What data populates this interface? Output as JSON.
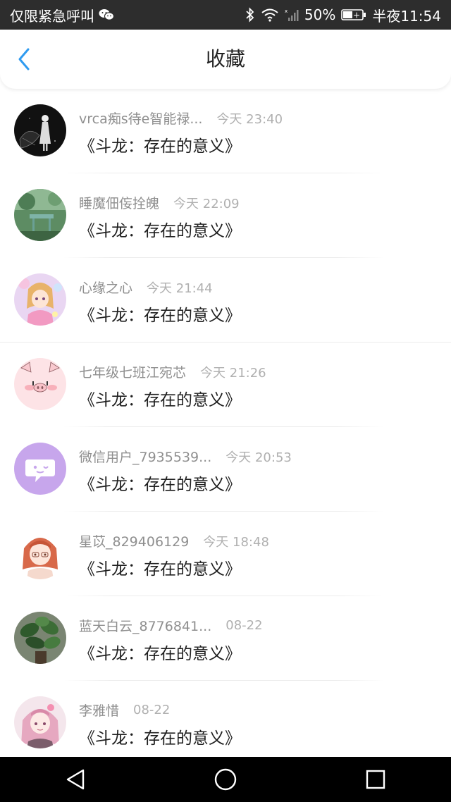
{
  "status_bar": {
    "left_text": "仅限紧急呼叫",
    "battery_percent": "50%",
    "clock": "半夜11:54",
    "icons": [
      "wechat-icon",
      "bluetooth-icon",
      "wifi-icon",
      "signal-icon",
      "battery-icon"
    ]
  },
  "header": {
    "title": "收藏",
    "back_icon": "chevron-left-icon",
    "accent_color": "#2f9bf0"
  },
  "items": [
    {
      "username": "vrca痴s待e智能禄...",
      "time": "今天 23:40",
      "content": "《斗龙：存在的意义》",
      "avatar": "dark-figure-avatar"
    },
    {
      "username": "睡魔佃侫拴魄",
      "time": "今天 22:09",
      "content": "《斗龙：存在的意义》",
      "avatar": "green-garden-avatar"
    },
    {
      "username": "心缘之心",
      "time": "今天 21:44",
      "content": "《斗龙：存在的意义》",
      "avatar": "anime-girl-avatar"
    },
    {
      "username": "七年级七班江宛芯",
      "time": "今天 21:26",
      "content": "《斗龙：存在的意义》",
      "avatar": "pig-face-avatar"
    },
    {
      "username": "微信用户_7935539...",
      "time": "今天 20:53",
      "content": "《斗龙：存在的意义》",
      "avatar": "chat-bubble-avatar"
    },
    {
      "username": "星苡_829406129",
      "time": "今天 18:48",
      "content": "《斗龙：存在的意义》",
      "avatar": "anime-redhair-avatar"
    },
    {
      "username": "蓝天白云_8776841...",
      "time": "08-22",
      "content": "《斗龙：存在的意义》",
      "avatar": "potted-plant-avatar"
    },
    {
      "username": "李雅惜",
      "time": "08-22",
      "content": "《斗龙：存在的意义》",
      "avatar": "anime-pink-avatar"
    }
  ],
  "nav_bar": {
    "back_icon": "triangle-back-icon",
    "home_icon": "circle-home-icon",
    "recents_icon": "square-recents-icon"
  }
}
